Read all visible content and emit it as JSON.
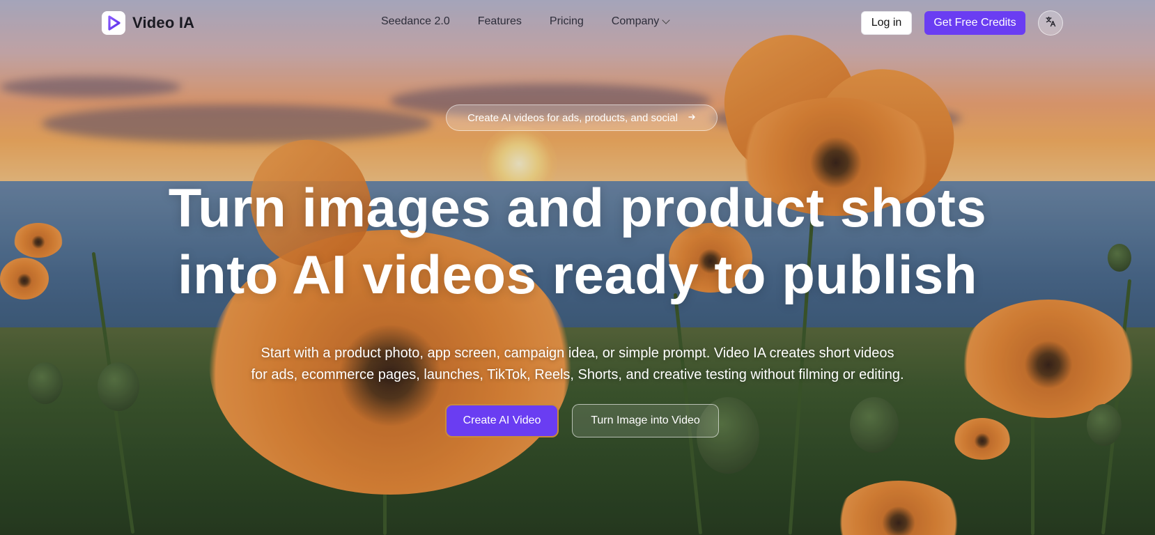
{
  "brand": {
    "name": "Video IA",
    "icon": "play-logo-icon",
    "accent": "#6a3df2"
  },
  "nav": {
    "links": [
      {
        "label": "Seedance 2.0"
      },
      {
        "label": "Features"
      },
      {
        "label": "Pricing"
      },
      {
        "label": "Company",
        "has_dropdown": true
      }
    ],
    "login_label": "Log in",
    "credits_label": "Get Free Credits",
    "language_icon": "translate-icon"
  },
  "hero": {
    "pill_text": "Create AI videos for ads, products, and social",
    "pill_icon": "arrow-right-icon",
    "headline_line1": "Turn images and product shots",
    "headline_line2": "into AI videos ready to publish",
    "subtext_line1": "Start with a product photo, app screen, campaign idea, or simple prompt. Video IA creates short videos",
    "subtext_line2": "for ads, ecommerce pages, launches, TikTok, Reels, Shorts, and creative testing without filming or editing.",
    "primary_cta": "Create AI Video",
    "secondary_cta": "Turn Image into Video"
  },
  "background": {
    "scene": "sunset-poppy-field"
  }
}
